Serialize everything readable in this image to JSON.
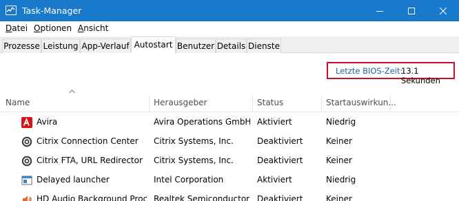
{
  "window": {
    "title": "Task-Manager",
    "controls": [
      "minimize",
      "maximize",
      "close"
    ]
  },
  "menu": [
    {
      "label_rest": "atei",
      "label_underlined": "D"
    },
    {
      "label_rest": "ptionen",
      "label_underlined": "O"
    },
    {
      "label_rest": "nsicht",
      "label_underlined": "A"
    }
  ],
  "tabs": [
    "Prozesse",
    "Leistung",
    "App-Verlauf",
    "Autostart",
    "Benutzer",
    "Details",
    "Dienste"
  ],
  "active_tab": "Autostart",
  "bios": {
    "label": "Letzte BIOS-Zeit:",
    "value": "13.1 Sekunden"
  },
  "columns": {
    "name": "Name",
    "publisher": "Herausgeber",
    "status": "Status",
    "impact": "Startauswirkun..."
  },
  "rows": [
    {
      "icon": "avira-icon",
      "name": "Avira",
      "publisher": "Avira Operations GmbH ...",
      "status": "Aktiviert",
      "impact": "Niedrig"
    },
    {
      "icon": "citrix-icon",
      "name": "Citrix Connection Center",
      "publisher": "Citrix Systems, Inc.",
      "status": "Deaktiviert",
      "impact": "Keiner"
    },
    {
      "icon": "citrix-icon",
      "name": "Citrix FTA, URL Redirector",
      "publisher": "Citrix Systems, Inc.",
      "status": "Deaktiviert",
      "impact": "Keiner"
    },
    {
      "icon": "app-window-icon",
      "name": "Delayed launcher",
      "publisher": "Intel Corporation",
      "status": "Aktiviert",
      "impact": "Niedrig"
    },
    {
      "icon": "speaker-icon",
      "name": "HD Audio Background Proc...",
      "publisher": "Realtek Semiconductor",
      "status": "Deaktiviert",
      "impact": "Keiner"
    }
  ],
  "colors": {
    "titlebar": "#1979ca",
    "bios_border": "#c8102e",
    "bios_label": "#1f5fa6",
    "avira_red": "#d7141a"
  }
}
